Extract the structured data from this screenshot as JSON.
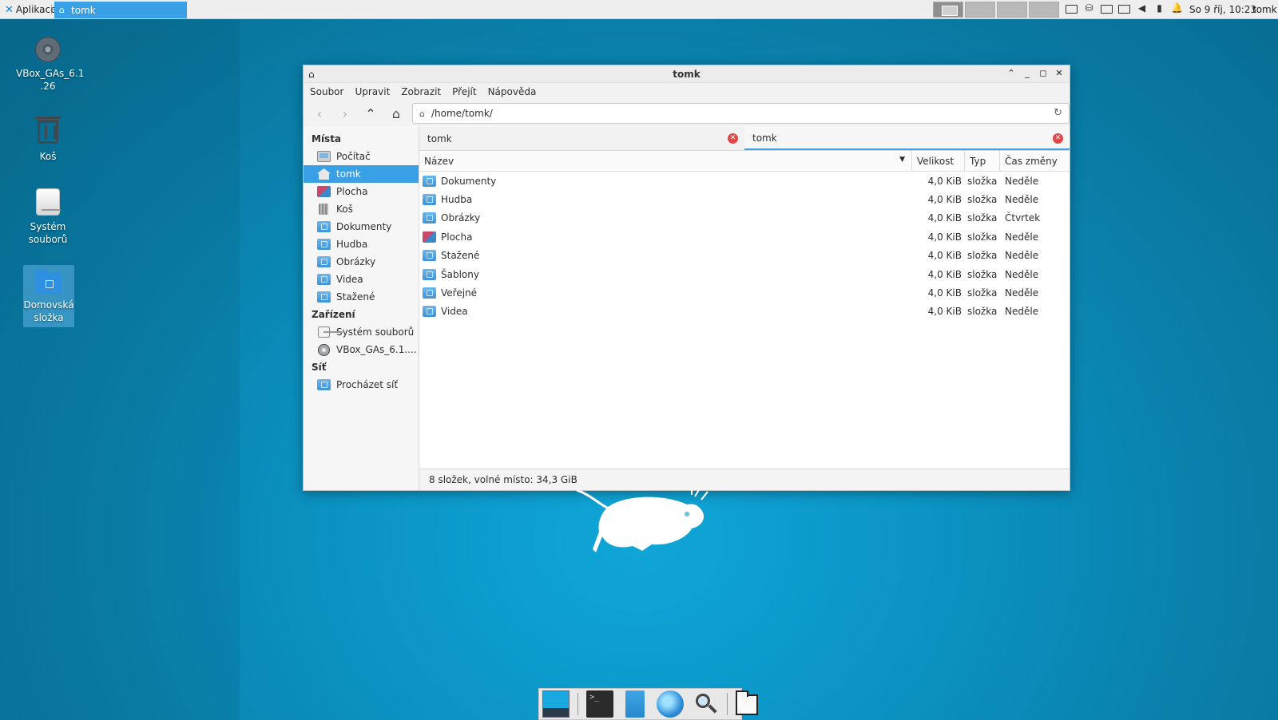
{
  "top_panel": {
    "apps_label": "Aplikace",
    "task_label": "tomk",
    "clock": "So 9 říj, 10:23",
    "user": "tomk"
  },
  "desktop_icons": [
    {
      "label": "VBox_GAs_6.1\n.26",
      "icon": "cd-icon"
    },
    {
      "label": "Koš",
      "icon": "trash-icon"
    },
    {
      "label": "Systém\nsouborů",
      "icon": "drive-icon"
    },
    {
      "label": "Domovská\nsložka",
      "icon": "home-folder-icon"
    }
  ],
  "window": {
    "title": "tomk",
    "menu": [
      "Soubor",
      "Upravit",
      "Zobrazit",
      "Přejít",
      "Nápověda"
    ],
    "location": "/home/tomk/",
    "sidebar": {
      "places_header": "Místa",
      "places": [
        "Počítač",
        "tomk",
        "Plocha",
        "Koš",
        "Dokumenty",
        "Hudba",
        "Obrázky",
        "Videa",
        "Stažené"
      ],
      "devices_header": "Zařízení",
      "devices": [
        "Systém souborů",
        "VBox_GAs_6.1...."
      ],
      "network_header": "Síť",
      "network": [
        "Procházet síť"
      ]
    },
    "tabs": [
      "tomk",
      "tomk"
    ],
    "columns": {
      "name": "Název",
      "size": "Velikost",
      "type": "Typ",
      "mtime": "Čas změny"
    },
    "rows": [
      {
        "name": "Dokumenty",
        "size": "4,0 KiB",
        "type": "složka",
        "mtime": "Neděle"
      },
      {
        "name": "Hudba",
        "size": "4,0 KiB",
        "type": "složka",
        "mtime": "Neděle"
      },
      {
        "name": "Obrázky",
        "size": "4,0 KiB",
        "type": "složka",
        "mtime": "Čtvrtek"
      },
      {
        "name": "Plocha",
        "size": "4,0 KiB",
        "type": "složka",
        "mtime": "Neděle"
      },
      {
        "name": "Stažené",
        "size": "4,0 KiB",
        "type": "složka",
        "mtime": "Neděle"
      },
      {
        "name": "Šablony",
        "size": "4,0 KiB",
        "type": "složka",
        "mtime": "Neděle"
      },
      {
        "name": "Veřejné",
        "size": "4,0 KiB",
        "type": "složka",
        "mtime": "Neděle"
      },
      {
        "name": "Videa",
        "size": "4,0 KiB",
        "type": "složka",
        "mtime": "Neděle"
      }
    ],
    "status": "8 složek, volné místo: 34,3 GiB"
  },
  "colors": {
    "accent": "#3aa0e6",
    "desktop": "#0a8fc0",
    "close_tab": "#e04848"
  }
}
